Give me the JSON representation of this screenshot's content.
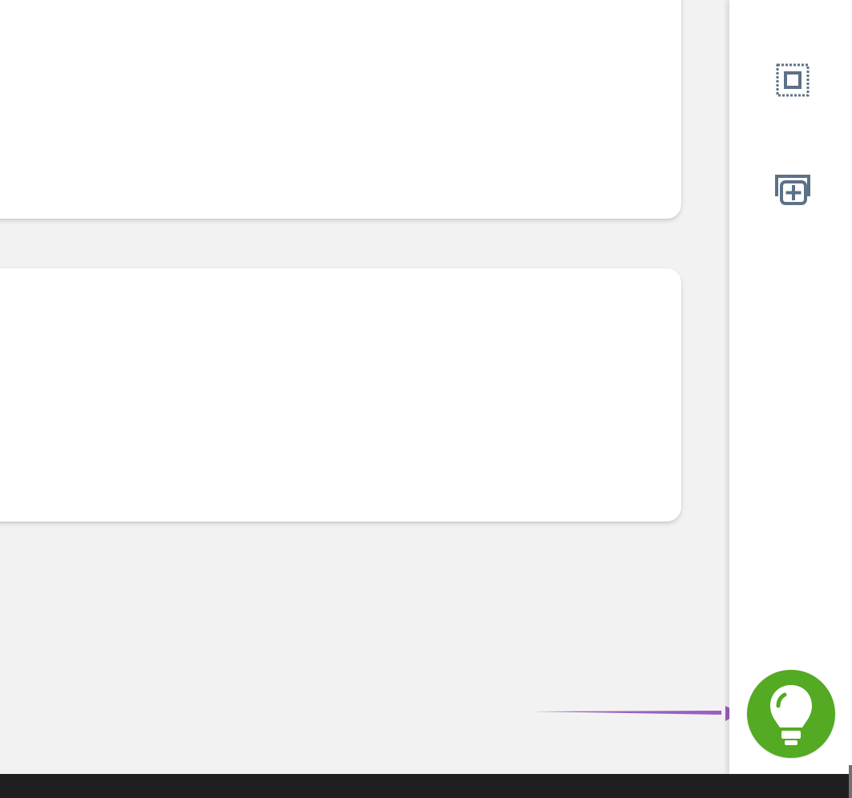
{
  "workspace": {
    "background_color": "#f2f2f2",
    "card_color": "#ffffff"
  },
  "toolbar": {
    "items": [
      {
        "icon": "select-area-icon"
      },
      {
        "icon": "add-layer-icon"
      }
    ],
    "tip_button": {
      "icon": "lightbulb-icon",
      "color": "#54aa22"
    }
  },
  "overlay": {
    "arrow_color": "#9b5fc0"
  },
  "taskbar": {
    "color": "#1f1f1f"
  }
}
